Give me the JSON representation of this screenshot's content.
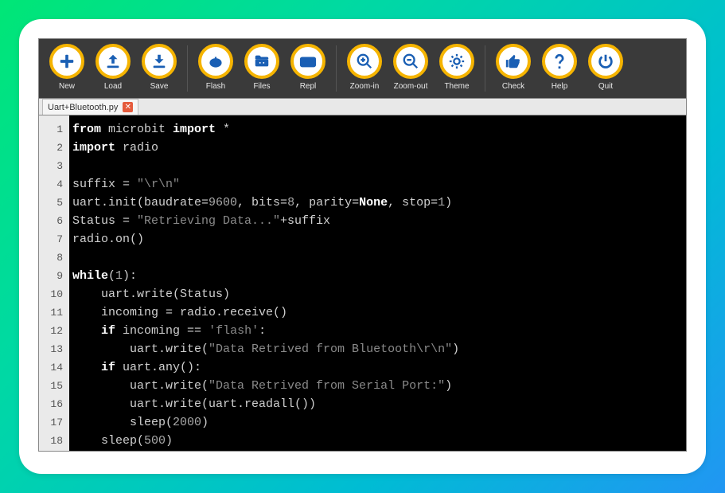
{
  "toolbar": {
    "new": "New",
    "load": "Load",
    "save": "Save",
    "flash": "Flash",
    "files": "Files",
    "repl": "Repl",
    "zoomin": "Zoom-in",
    "zoomout": "Zoom-out",
    "theme": "Theme",
    "check": "Check",
    "help": "Help",
    "quit": "Quit"
  },
  "tab": {
    "filename": "Uart+Bluetooth.py"
  },
  "code": {
    "lines": [
      {
        "n": 1,
        "tokens": [
          [
            "kw",
            "from"
          ],
          [
            "",
            " microbit "
          ],
          [
            "kw",
            "import"
          ],
          [
            "",
            " *"
          ]
        ]
      },
      {
        "n": 2,
        "tokens": [
          [
            "kw",
            "import"
          ],
          [
            "",
            " radio"
          ]
        ]
      },
      {
        "n": 3,
        "tokens": [
          [
            "",
            ""
          ]
        ]
      },
      {
        "n": 4,
        "tokens": [
          [
            "",
            "suffix = "
          ],
          [
            "str",
            "\"\\r\\n\""
          ]
        ]
      },
      {
        "n": 5,
        "tokens": [
          [
            "",
            "uart.init(baudrate="
          ],
          [
            "num",
            "9600"
          ],
          [
            "",
            ", bits="
          ],
          [
            "num",
            "8"
          ],
          [
            "",
            ", parity="
          ],
          [
            "none",
            "None"
          ],
          [
            "",
            ", stop="
          ],
          [
            "num",
            "1"
          ],
          [
            "",
            ")"
          ]
        ]
      },
      {
        "n": 6,
        "tokens": [
          [
            "",
            "Status = "
          ],
          [
            "str",
            "\"Retrieving Data...\""
          ],
          [
            "",
            "+suffix"
          ]
        ]
      },
      {
        "n": 7,
        "tokens": [
          [
            "",
            "radio.on()"
          ]
        ]
      },
      {
        "n": 8,
        "tokens": [
          [
            "",
            ""
          ]
        ]
      },
      {
        "n": 9,
        "tokens": [
          [
            "kw",
            "while"
          ],
          [
            "",
            "("
          ],
          [
            "num",
            "1"
          ],
          [
            "",
            "):"
          ]
        ]
      },
      {
        "n": 10,
        "tokens": [
          [
            "",
            "    uart.write(Status)"
          ]
        ]
      },
      {
        "n": 11,
        "tokens": [
          [
            "",
            "    incoming = radio.receive()"
          ]
        ]
      },
      {
        "n": 12,
        "tokens": [
          [
            "",
            "    "
          ],
          [
            "kw",
            "if"
          ],
          [
            "",
            " incoming == "
          ],
          [
            "str",
            "'flash'"
          ],
          [
            "",
            ":"
          ]
        ]
      },
      {
        "n": 13,
        "tokens": [
          [
            "",
            "        uart.write("
          ],
          [
            "str",
            "\"Data Retrived from Bluetooth\\r\\n\""
          ],
          [
            "",
            ")"
          ]
        ]
      },
      {
        "n": 14,
        "tokens": [
          [
            "",
            "    "
          ],
          [
            "kw",
            "if"
          ],
          [
            "",
            " uart.any():"
          ]
        ]
      },
      {
        "n": 15,
        "tokens": [
          [
            "",
            "        uart.write("
          ],
          [
            "str",
            "\"Data Retrived from Serial Port:\""
          ],
          [
            "",
            ")"
          ]
        ]
      },
      {
        "n": 16,
        "tokens": [
          [
            "",
            "        uart.write(uart.readall())"
          ]
        ]
      },
      {
        "n": 17,
        "tokens": [
          [
            "",
            "        sleep("
          ],
          [
            "num",
            "2000"
          ],
          [
            "",
            ")"
          ]
        ]
      },
      {
        "n": 18,
        "tokens": [
          [
            "",
            "    sleep("
          ],
          [
            "num",
            "500"
          ],
          [
            "",
            ")"
          ]
        ]
      }
    ]
  }
}
